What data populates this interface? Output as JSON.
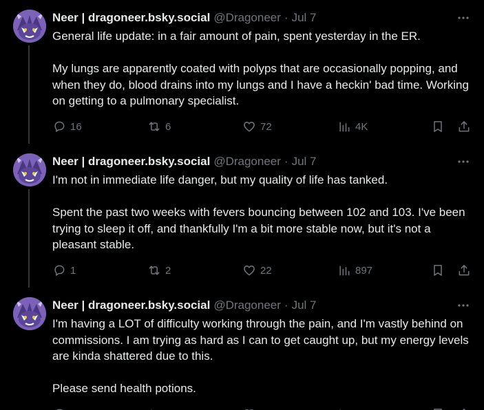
{
  "colors": {
    "background": "#000000",
    "text": "#e7e9ea",
    "muted": "#71767b",
    "thread_line": "#333639"
  },
  "tweets": [
    {
      "display_name": "Neer | dragoneer.bsky.social",
      "handle": "@Dragoneer",
      "separator": "·",
      "date": "Jul 7",
      "paragraphs": [
        "General life update: in a fair amount of pain, spent yesterday in the ER.",
        "My lungs are apparently coated with polyps that are occasionally popping, and when they do, blood drains into my lungs and I have a heckin' bad time. Working on getting to a pulmonary specialist."
      ],
      "replies": "16",
      "reposts": "6",
      "likes": "72",
      "views": "4K"
    },
    {
      "display_name": "Neer | dragoneer.bsky.social",
      "handle": "@Dragoneer",
      "separator": "·",
      "date": "Jul 7",
      "paragraphs": [
        "I'm not in immediate life danger, but my quality of life has tanked.",
        "Spent the past two weeks with fevers bouncing between 102 and 103. I've been trying to sleep it off, and thankfully I'm a bit more stable now, but it's not a pleasant stable."
      ],
      "replies": "1",
      "reposts": "2",
      "likes": "22",
      "views": "897"
    },
    {
      "display_name": "Neer | dragoneer.bsky.social",
      "handle": "@Dragoneer",
      "separator": "·",
      "date": "Jul 7",
      "paragraphs": [
        "I'm having a LOT of difficulty working through the pain, and I'm vastly behind on commissions. I am trying as hard as I can to get caught up, but my energy levels are kinda shattered due to this.",
        "Please send health potions."
      ]
    }
  ]
}
